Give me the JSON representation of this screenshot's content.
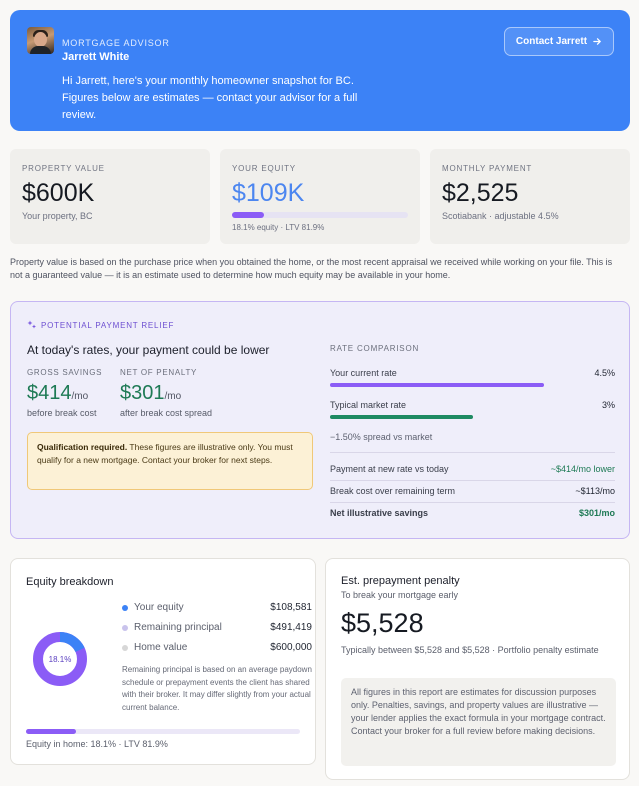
{
  "advisor": {
    "role": "MORTGAGE ADVISOR",
    "name": "Jarrett White",
    "contact_label": "Contact Jarrett",
    "greeting": "Hi Jarrett, here's your monthly homeowner snapshot for BC. Figures below are estimates — contact your advisor for a full review."
  },
  "stats": {
    "property": {
      "label": "PROPERTY VALUE",
      "value": "$600K",
      "sub": "Your property, BC"
    },
    "equity": {
      "label": "YOUR EQUITY",
      "value": "$109K",
      "sub": "18.1% equity · LTV 81.9%",
      "fraction": 0.181
    },
    "payment": {
      "label": "MONTHLY PAYMENT",
      "value": "$2,525",
      "sub": "Scotiabank · adjustable 4.5%"
    }
  },
  "disclaimer": "Property value is based on the purchase price when you obtained the home, or the most recent appraisal we received while working on your file. This is not a guaranteed value — it is an estimate used to determine how much equity may be available in your home.",
  "relief": {
    "tag": "POTENTIAL PAYMENT RELIEF",
    "headline": "At today's rates, your payment could be lower",
    "gross_label": "GROSS SAVINGS",
    "gross_value": "$414",
    "gross_unit": "/mo",
    "gross_note": "before break cost",
    "net_label": "NET OF PENALTY",
    "net_value": "$301",
    "net_unit": "/mo",
    "net_note": "after break cost spread",
    "qual_bold": "Qualification required.",
    "qual_text": " These figures are illustrative only. You must qualify for a new mortgage. Contact your broker for next steps.",
    "rate_comparison_label": "RATE COMPARISON",
    "current_rate_label": "Your current rate",
    "current_rate_value": "4.5%",
    "current_rate_level": 0.75,
    "market_rate_label": "Typical market rate",
    "market_rate_value": "3%",
    "market_rate_level": 0.5,
    "spread_note": "−1.50% spread vs market",
    "rows": [
      {
        "label": "Payment at new rate vs today",
        "value": "~$414/mo lower"
      },
      {
        "label": "Break cost over remaining term",
        "value": "~$113/mo"
      },
      {
        "label": "Net illustrative savings",
        "value": "$301/mo"
      }
    ]
  },
  "equity_breakdown": {
    "title": "Equity breakdown",
    "donut_label": "18.1%",
    "equity_fraction": 0.181,
    "items": [
      {
        "label": "Your equity",
        "value": "$108,581",
        "color": "#3c82f6"
      },
      {
        "label": "Remaining principal",
        "value": "$491,419",
        "color": "#c9c3ec"
      },
      {
        "label": "Home value",
        "value": "$600,000",
        "color": "#d7d7d7"
      }
    ],
    "note": "Remaining principal is based on an average paydown schedule or prepayment events the client has shared with their broker. It may differ slightly from your actual current balance.",
    "footer": "Equity in home: 18.1% · LTV 81.9%"
  },
  "prepayment": {
    "title": "Est. prepayment penalty",
    "subtitle": "To break your mortgage early",
    "value": "$5,528",
    "range": "Typically between $5,528 and $5,528 · Portfolio penalty estimate",
    "disclaimer": "All figures in this report are estimates for discussion purposes only. Penalties, savings, and property values are illustrative — your lender applies the exact formula in your mortgage contract. Contact your broker for a full review before making decisions."
  }
}
